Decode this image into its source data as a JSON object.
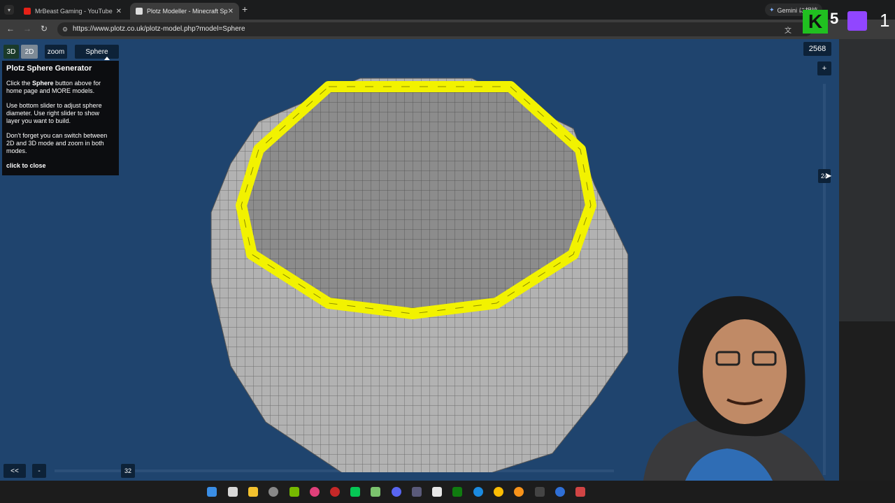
{
  "browser": {
    "tabs": [
      {
        "title": "MrBeast Gaming - YouTube",
        "active": false
      },
      {
        "title": "Plotz Modeller - Minecraft Sphe",
        "active": true
      }
    ],
    "new_tab_symbol": "+",
    "url": "https://www.plotz.co.uk/plotz-model.php?model=Sphere",
    "gemini_label": "Gemini に相談",
    "back_symbol": "←",
    "forward_symbol": "→",
    "reload_symbol": "↻",
    "close_symbol": "✕"
  },
  "plotz": {
    "mode_3d": "3D",
    "mode_2d": "2D",
    "zoom_label": "zoom",
    "model_label": "Sphere",
    "block_count": "2568",
    "plus_label": "+",
    "layer_value": "24",
    "prev_label": "<<",
    "minus_label": "-",
    "diameter_value": "32",
    "info": {
      "title": "Plotz Sphere Generator",
      "p1_pre": "Click the ",
      "p1_bold": "Sphere",
      "p1_post": " button above for home page and MORE models.",
      "p2": "Use bottom slider to adjust sphere diameter. Use right slider to show layer you want to build.",
      "p3": "Don't forget you can switch between 2D and 3D mode and zoom in both modes.",
      "close": "click to close"
    },
    "colors": {
      "background": "#1f446e",
      "block": "#b4b4b4",
      "highlight": "#f2f200"
    }
  },
  "overlay": {
    "brand_letter": "K",
    "brand_num": "5",
    "brand_right": "1"
  }
}
